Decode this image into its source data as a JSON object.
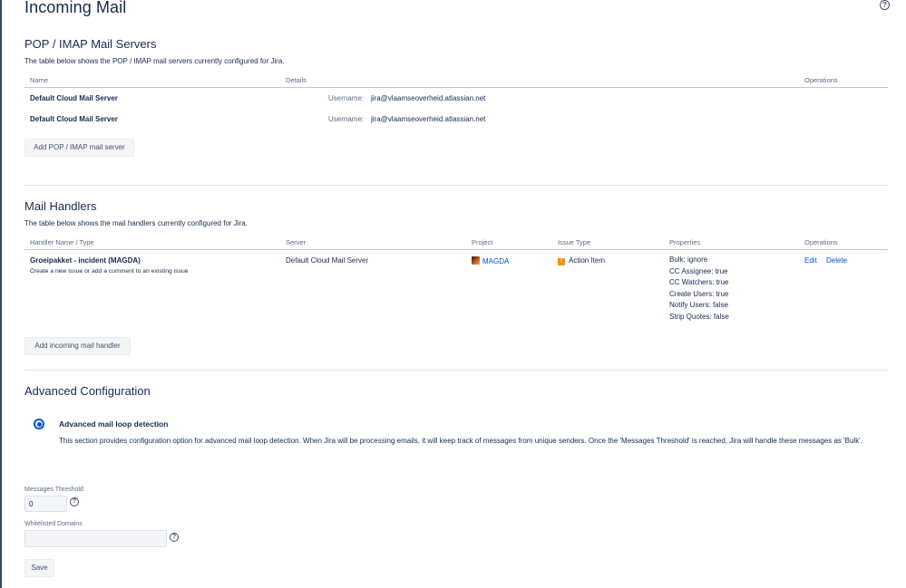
{
  "page": {
    "title": "Incoming Mail",
    "help_glyph": "?"
  },
  "mail_servers": {
    "title": "POP / IMAP Mail Servers",
    "description": "The table below shows the POP / IMAP mail servers currently configured for Jira.",
    "columns": [
      "Name",
      "Details",
      "Operations"
    ],
    "rows": [
      {
        "name": "Default Cloud Mail Server",
        "username_label": "Username:",
        "username": "jira@vlaamseoverheid.atlassian.net"
      },
      {
        "name": "Default Cloud Mail Server",
        "username_label": "Username:",
        "username": "jira@vlaamseoverheid.atlassian.net"
      }
    ],
    "add_button": "Add POP / IMAP mail server"
  },
  "mail_handlers": {
    "title": "Mail Handlers",
    "description": "The table below shows the mail handlers currently configured for Jira.",
    "columns": [
      "Handler Name / Type",
      "Server",
      "Project",
      "Issue Type",
      "Properties",
      "Operations"
    ],
    "rows": [
      {
        "name": "Groeipakket - incident (MAGDA)",
        "type": "Create a new issue or add a comment to an existing issue",
        "server": "Default Cloud Mail Server",
        "project": "MAGDA",
        "issue_type": "Action Item",
        "properties": [
          "Bulk: ignore",
          "CC Assignee: true",
          "CC Watchers: true",
          "Create Users: true",
          "Notify Users: false",
          "Strip Quotes: false"
        ],
        "edit_label": "Edit",
        "delete_label": "Delete"
      }
    ],
    "add_button": "Add incoming mail handler"
  },
  "advanced": {
    "title": "Advanced Configuration",
    "info_title": "Advanced mail loop detection",
    "info_text": "This section provides configuration option for advanced mail loop detection. When Jira will be processing emails, it will keep track of messages from unique senders. Once the 'Messages Threshold' is reached, Jira will handle these messages as 'Bulk'.",
    "threshold_label": "Messages Threshold",
    "threshold_value": "0",
    "domains_label": "Whitelisted Domains",
    "domains_value": "",
    "save_button": "Save"
  },
  "colors": {
    "text": "#172b4d",
    "link": "#0052cc",
    "issue_type": "#ff8b00"
  }
}
